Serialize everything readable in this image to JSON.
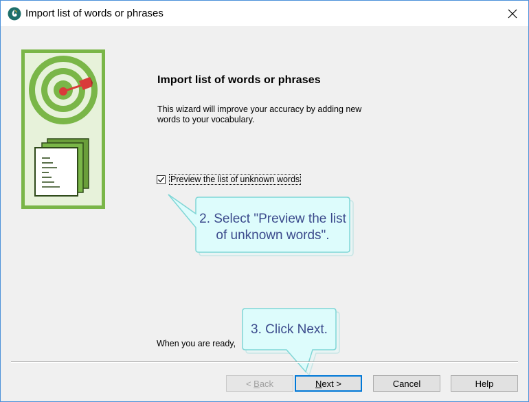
{
  "window": {
    "title": "Import list of words or phrases",
    "close_glyph": "✕"
  },
  "page": {
    "heading": "Import list of words or phrases",
    "description": "This wizard will improve your accuracy by adding new words to your vocabulary.",
    "checkbox": {
      "label": "Preview the list of unknown words",
      "checked": true
    },
    "ready_text": "When you are ready,"
  },
  "callouts": [
    {
      "text_line1": "2. Select \"Preview the list",
      "text_line2": "of unknown words\"."
    },
    {
      "text": "3. Click Next."
    }
  ],
  "buttons": {
    "back": {
      "prefix": "< ",
      "accel": "B",
      "rest": "ack",
      "enabled": false
    },
    "next": {
      "accel": "N",
      "rest": "ext >",
      "enabled": true
    },
    "cancel": {
      "label": "Cancel"
    },
    "help": {
      "label": "Help"
    }
  },
  "icons": {
    "app": "dragon-icon",
    "illustration": "target-documents-icon"
  },
  "colors": {
    "callout_fill": "#ddfcfc",
    "callout_border": "#7fd6d6",
    "callout_text": "#3b4a8c",
    "illustration_green": "#7ab648",
    "accent": "#0078d7"
  }
}
